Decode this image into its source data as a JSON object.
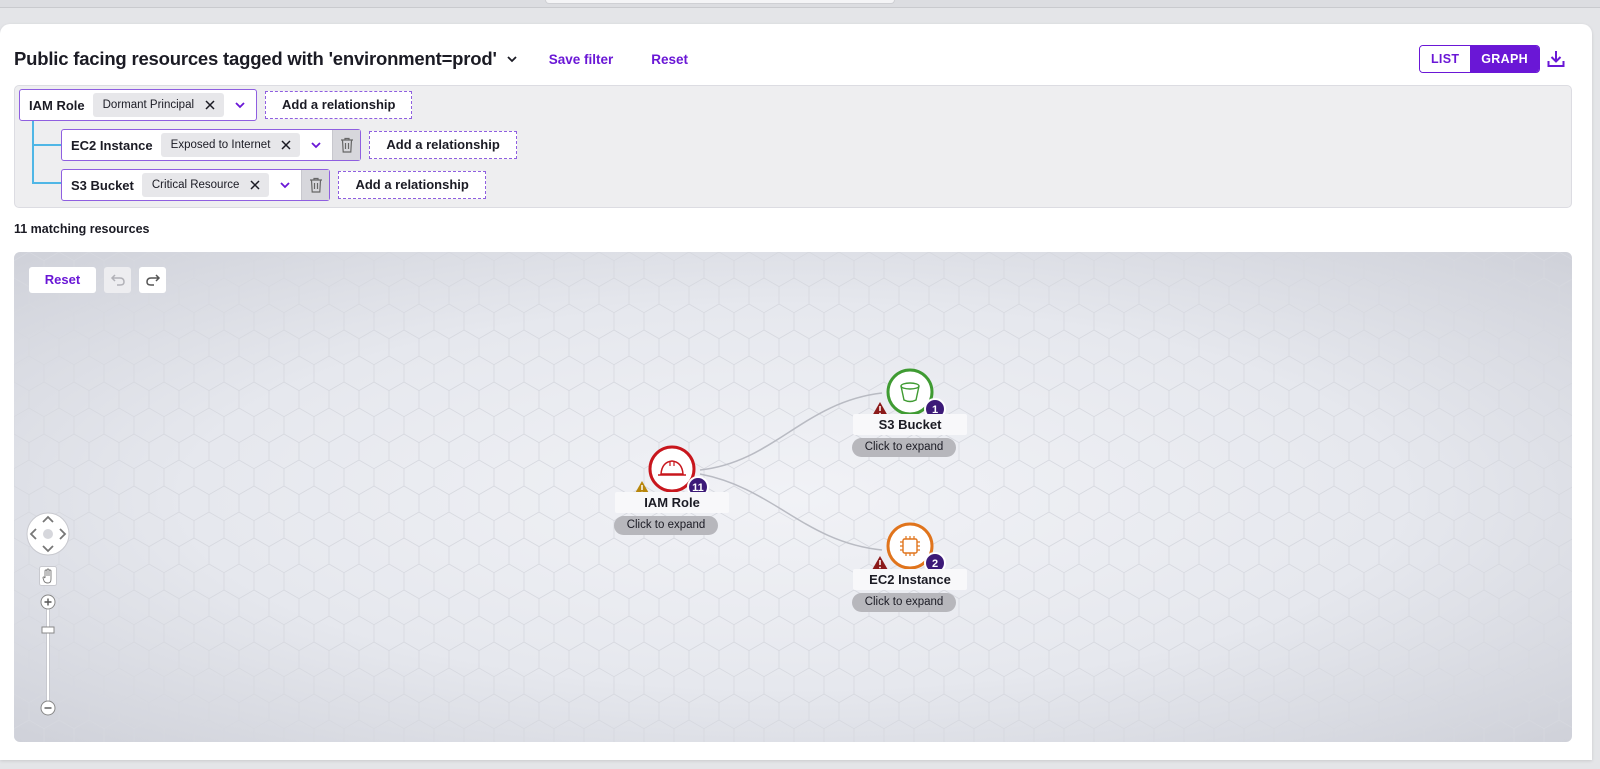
{
  "page": {
    "title": "Public facing resources tagged with 'environment=prod'",
    "save_filter": "Save filter",
    "reset": "Reset"
  },
  "view_toggle": {
    "list": "LIST",
    "graph": "GRAPH",
    "selected": "GRAPH"
  },
  "filters": [
    {
      "entity": "IAM Role",
      "tag": "Dormant Principal",
      "add": "Add a relationship",
      "deletable": false
    },
    {
      "entity": "EC2 Instance",
      "tag": "Exposed to Internet",
      "add": "Add a relationship",
      "deletable": true
    },
    {
      "entity": "S3 Bucket",
      "tag": "Critical Resource",
      "add": "Add a relationship",
      "deletable": true
    }
  ],
  "results": {
    "count_text": "11 matching resources"
  },
  "graph": {
    "reset": "Reset",
    "nodes": [
      {
        "label": "IAM Role",
        "count": "11",
        "expand": "Click to expand",
        "color": "#c8161d",
        "warning": "#b8860b",
        "icon": "hard-hat-icon"
      },
      {
        "label": "S3 Bucket",
        "count": "1",
        "expand": "Click to expand",
        "color": "#3f9b32",
        "warning": "#8b1a1a",
        "icon": "bucket-icon"
      },
      {
        "label": "EC2 Instance",
        "count": "2",
        "expand": "Click to expand",
        "color": "#e0741c",
        "warning": "#8b1a1a",
        "icon": "chip-icon"
      }
    ]
  },
  "colors": {
    "accent": "#6a17d6",
    "badge": "#3c1a78",
    "tree": "#4fb6e6"
  }
}
